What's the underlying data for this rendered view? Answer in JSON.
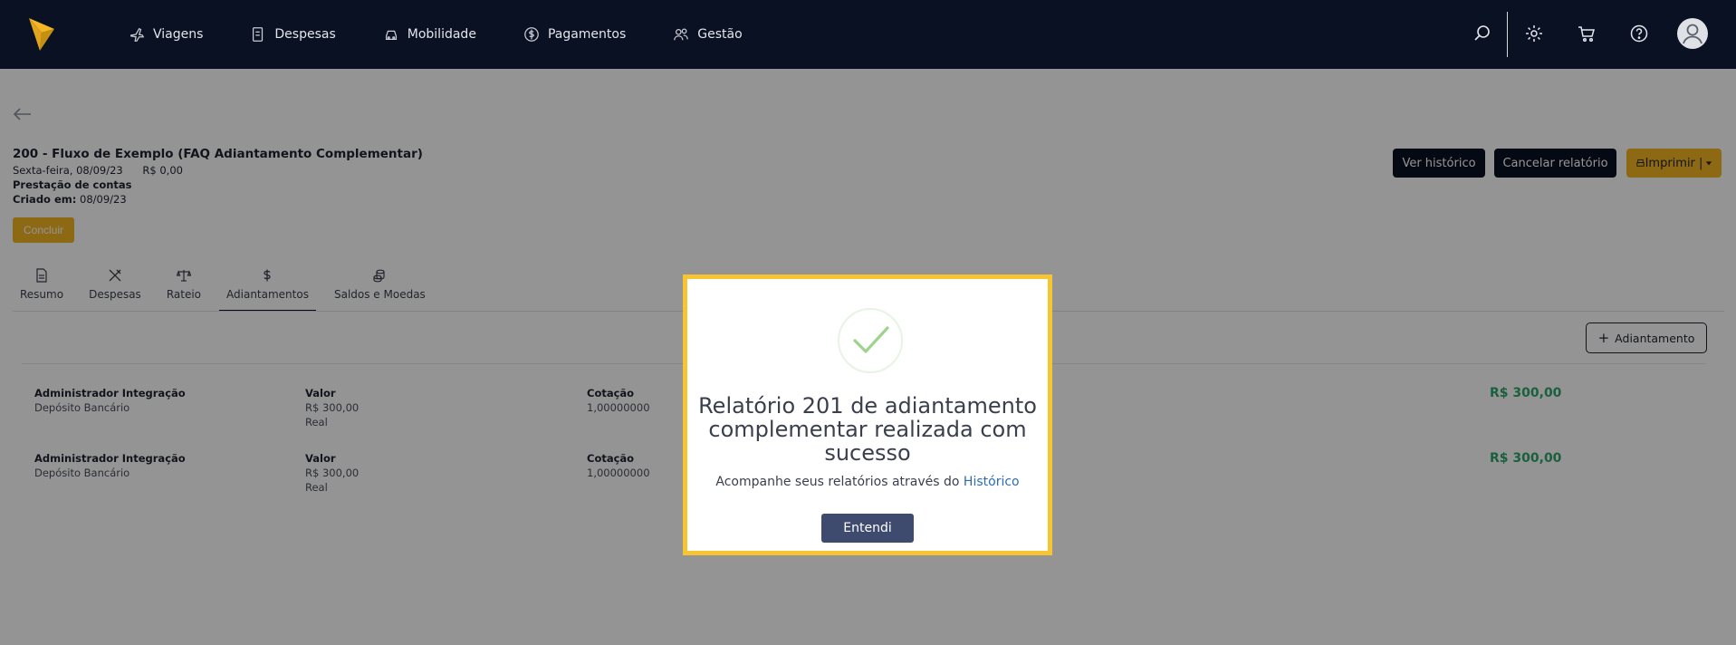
{
  "nav": {
    "items": [
      {
        "label": "Viagens",
        "icon": "plane-icon"
      },
      {
        "label": "Despesas",
        "icon": "receipt-icon"
      },
      {
        "label": "Mobilidade",
        "icon": "car-icon"
      },
      {
        "label": "Pagamentos",
        "icon": "dollar-icon"
      },
      {
        "label": "Gestão",
        "icon": "users-icon"
      }
    ]
  },
  "report": {
    "title": "200 - Fluxo de Exemplo (FAQ Adiantamento Complementar)",
    "date": "Sexta-feira, 08/09/23",
    "total": "R$ 0,00",
    "type": "Prestação de contas",
    "created_label": "Criado em:",
    "created_value": "08/09/23",
    "conclude_label": "Concluir"
  },
  "actions": {
    "history": "Ver histórico",
    "cancel": "Cancelar relatório",
    "print": "Imprimir |"
  },
  "tabs": [
    {
      "label": "Resumo",
      "icon": "document-icon"
    },
    {
      "label": "Despesas",
      "icon": "utensils-icon"
    },
    {
      "label": "Rateio",
      "icon": "scale-icon"
    },
    {
      "label": "Adiantamentos",
      "icon": "dollar-sign-icon"
    },
    {
      "label": "Saldos e Moedas",
      "icon": "coins-icon"
    }
  ],
  "add_advance_label": "Adiantamento",
  "advances": [
    {
      "name": "Administrador Integração",
      "method": "Depósito Bancário",
      "value_label": "Valor",
      "value": "R$ 300,00",
      "currency": "Real",
      "rate_label": "Cotação",
      "rate": "1,00000000",
      "amount": "R$ 300,00"
    },
    {
      "name": "Administrador Integração",
      "method": "Depósito Bancário",
      "value_label": "Valor",
      "value": "R$ 300,00",
      "currency": "Real",
      "rate_label": "Cotação",
      "rate": "1,00000000",
      "amount": "R$ 300,00"
    }
  ],
  "modal": {
    "title": "Relatório 201 de adiantamento complementar realizada com sucesso",
    "subtitle": "Acompanhe seus relatórios através do",
    "link": "Histórico",
    "button": "Entendi"
  },
  "colors": {
    "brand_dark": "#0a1122",
    "accent": "#f4b623",
    "success": "#2fa56b",
    "modal_button": "#3f4a6f"
  }
}
